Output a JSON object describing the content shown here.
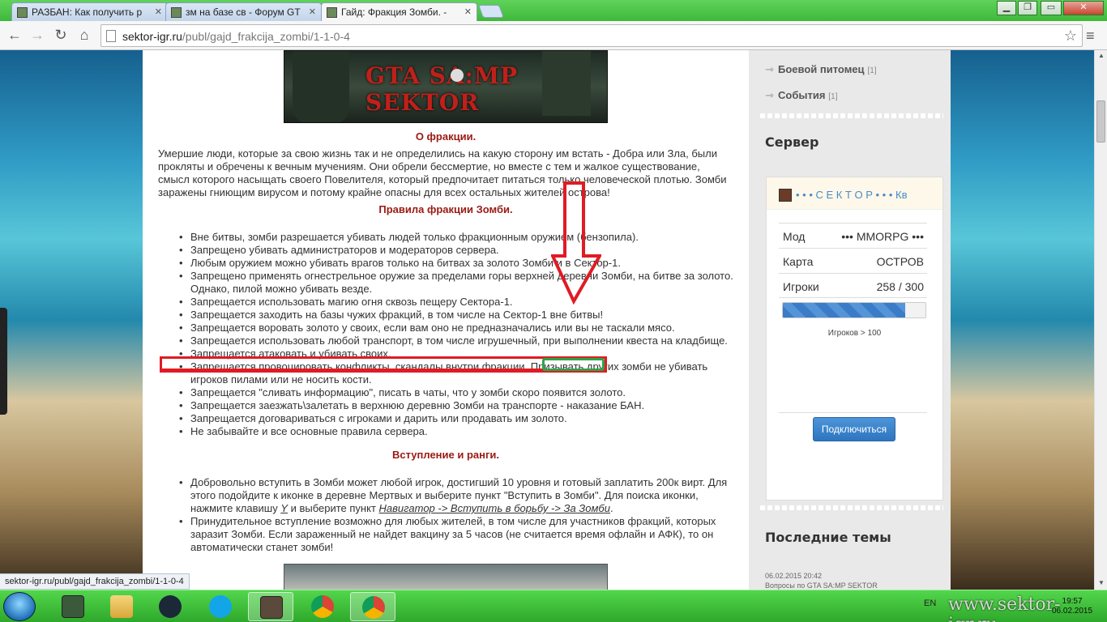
{
  "browser": {
    "tabs": [
      {
        "title": "РАЗБАН: Как получить р"
      },
      {
        "title": "зм на базе св - Форум GT"
      },
      {
        "title": "Гайд: Фракция Зомби. - "
      }
    ],
    "url_host": "sektor-igr.ru",
    "url_path": "/publ/gajd_frakcija_zombi/1-1-0-4",
    "status_url": "sektor-igr.ru/publ/gajd_frakcija_zombi/1-1-0-4"
  },
  "article": {
    "banner_text": "GTA SA:MP SEKTOR",
    "about_heading": "О фракции.",
    "about_text": "Умершие люди, которые за свою жизнь так и не определились на какую сторону им встать - Добра или Зла, были прокляты и обречены к вечным мучениям. Они обрели бессмертие, но вместе с тем и жалкое существование, смысл которого насыщать своего Повелителя, который предпочитает питаться только человеческой плотью. Зомби заражены гниющим вирусом и потому крайне опасны для всех остальных жителей острова!",
    "rules_heading": "Правила фракции Зомби.",
    "rules": [
      "Вне битвы, зомби разрешается убивать людей только фракционным оружием (бензопила).",
      "Запрещено убивать администраторов и модераторов сервера.",
      "Любым оружием можно убивать врагов только на битвах за золото Зомби и в Сектор-1.",
      "Запрещено применять огнестрельное оружие за пределами горы верхней деревни Зомби, на битве за золото. Однако, пилой можно убивать везде.",
      "Запрещается использовать магию огня сквозь пещеру Сектора-1.",
      "Запрещается заходить на базы чужих фракций, в том числе на Сектор-1 вне битвы!",
      "Запрещается воровать золото у своих, если вам оно не предназначались или вы не таскали мясо.",
      "Запрещается использовать любой транспорт, в том числе игрушечный, при выполнении квеста на кладбище.",
      "Запрещается атаковать и убивать своих.",
      "Запрещается провоцировать конфликты, скандалы внутри фракции. Призывать других зомби не убивать игроков пилами или не носить кости.",
      "Запрещается \"сливать информацию\", писать в чаты, что у зомби скоро появится золото.",
      "Запрещается заезжать\\залетать в верхнюю деревню Зомби на транспорте - наказание БАН.",
      "Запрещается договариваться с игроками и дарить или продавать им золото.",
      "Не забывайте и все основные правила сервера."
    ],
    "join_heading": "Вступление и ранги.",
    "join_p1_a": "Добровольно вступить в Зомби может любой игрок, достигший 10 уровня и готовый заплатить 200к вирт. Для этого подойдите к иконке в деревне Мертвых и выберите пункт \"Вступить в Зомби\". Для поиска иконки, нажмите клавишу ",
    "join_p1_key": "Y",
    "join_p1_b": " и выберите пункт ",
    "join_p1_path": "Навигатор -> Вступить в борьбу -> За Зомби",
    "join_p1_c": ".",
    "join_p2": "Принудительное вступление возможно для любых жителей, в том числе для участников фракций, которых заразит Зомби. Если зараженный не найдет вакцину за 5 часов (не считается время офлайн и АФК), то он автоматически станет зомби!"
  },
  "sidebar": {
    "links": [
      {
        "label": "Боевой питомец",
        "count": "[1]"
      },
      {
        "label": "События",
        "count": "[1]"
      }
    ],
    "server_heading": "Сервер",
    "server_name": "• • • С Е К Т О Р • • • Кв",
    "rows": [
      {
        "key": "Мод",
        "value": "••• MMORPG •••"
      },
      {
        "key": "Карта",
        "value": "ОСТРОВ"
      },
      {
        "key": "Игроки",
        "value": "258 / 300"
      }
    ],
    "players_fraction": 0.86,
    "players_note": "Игроков > 100",
    "connect_label": "Подключиться",
    "topics_heading": "Последние темы",
    "topic_date": "06.02.2015 20:42",
    "topic_title": "Вопросы по GTA SA:MP SEKTOR"
  },
  "taskbar": {
    "lang": "EN",
    "time": "19:57",
    "date": "06.02.2015",
    "watermark": "www.sektor-igr.ru"
  },
  "colors": {
    "heading_red": "#9a1a12",
    "annotation_red": "#e01b24",
    "annotation_green": "#2da44a",
    "link_blue": "#4a8bc7"
  }
}
